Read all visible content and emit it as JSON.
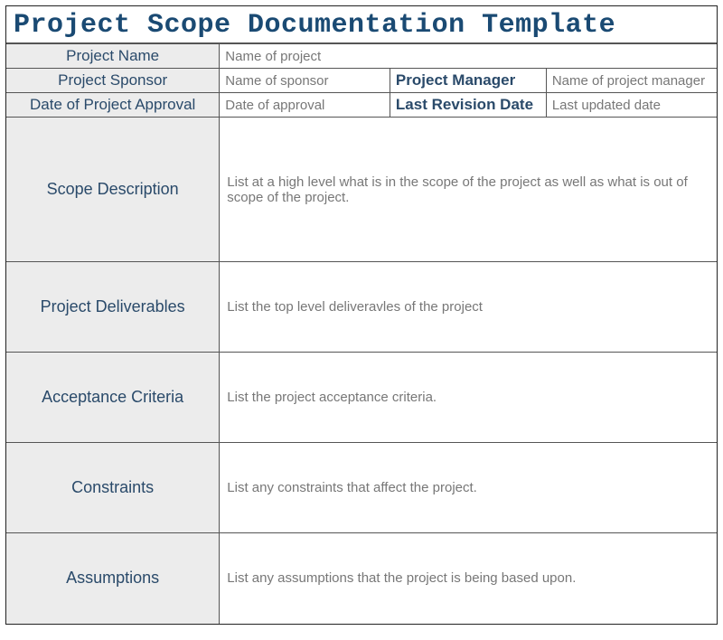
{
  "title": "Project Scope Documentation Template",
  "header": {
    "projectName": {
      "label": "Project Name",
      "value": "Name of project"
    },
    "projectSponsor": {
      "label": "Project Sponsor",
      "value": "Name of sponsor"
    },
    "projectManager": {
      "label": "Project Manager",
      "value": "Name of project manager"
    },
    "approvalDate": {
      "label": "Date of Project Approval",
      "value": "Date of approval"
    },
    "revisionDate": {
      "label": "Last Revision Date",
      "value": "Last updated date"
    }
  },
  "sections": {
    "scope": {
      "label": "Scope Description",
      "value": "List at a high level what is in the scope of the project as well as what is out of scope of the project."
    },
    "deliverables": {
      "label": "Project Deliverables",
      "value": "List the top level deliveravles of the project"
    },
    "acceptance": {
      "label": "Acceptance Criteria",
      "value": "List the project acceptance criteria."
    },
    "constraints": {
      "label": "Constraints",
      "value": "List any constraints that affect the project."
    },
    "assumptions": {
      "label": "Assumptions",
      "value": "List any assumptions that the project is being based upon."
    }
  }
}
